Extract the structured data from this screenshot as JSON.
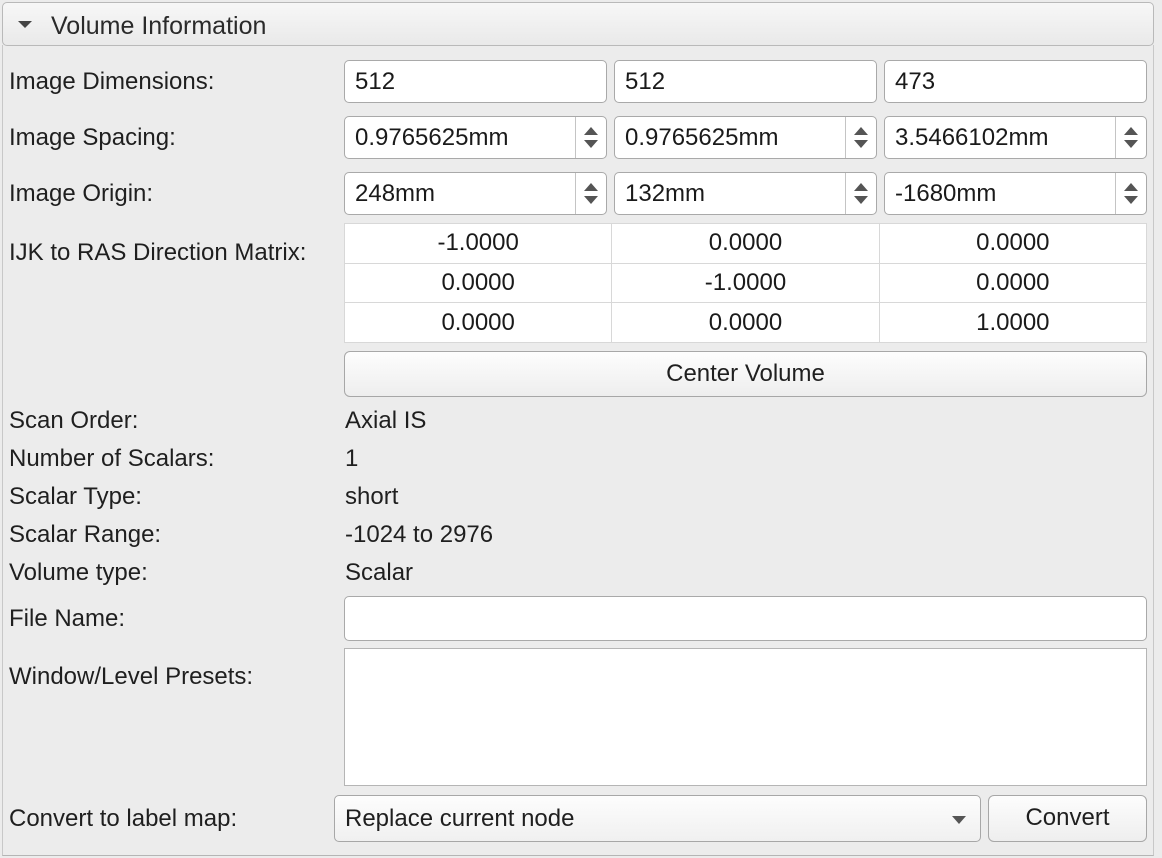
{
  "panel": {
    "title": "Volume Information"
  },
  "dimensions": {
    "label": "Image Dimensions:",
    "values": [
      "512",
      "512",
      "473"
    ]
  },
  "spacing": {
    "label": "Image Spacing:",
    "values": [
      "0.9765625mm",
      "0.9765625mm",
      "3.5466102mm"
    ]
  },
  "origin": {
    "label": "Image Origin:",
    "values": [
      "248mm",
      "132mm",
      "-1680mm"
    ]
  },
  "matrix": {
    "label": "IJK to RAS Direction Matrix:",
    "rows": [
      [
        "-1.0000",
        "0.0000",
        "0.0000"
      ],
      [
        "0.0000",
        "-1.0000",
        "0.0000"
      ],
      [
        "0.0000",
        "0.0000",
        "1.0000"
      ]
    ]
  },
  "center_button": "Center Volume",
  "info": {
    "scan_order_label": "Scan Order:",
    "scan_order": "Axial IS",
    "num_scalars_label": "Number of Scalars:",
    "num_scalars": "1",
    "scalar_type_label": "Scalar Type:",
    "scalar_type": "short",
    "scalar_range_label": "Scalar Range:",
    "scalar_range": "-1024 to 2976",
    "volume_type_label": "Volume type:",
    "volume_type": "Scalar"
  },
  "file_name": {
    "label": "File Name:",
    "value": ""
  },
  "presets": {
    "label": "Window/Level Presets:"
  },
  "convert": {
    "label": "Convert to label map:",
    "selected": "Replace current node",
    "button": "Convert"
  },
  "icons": {
    "collapse": "triangle-down-icon",
    "spin": "spin-arrows-icon",
    "dropdown": "chevron-down-icon"
  }
}
